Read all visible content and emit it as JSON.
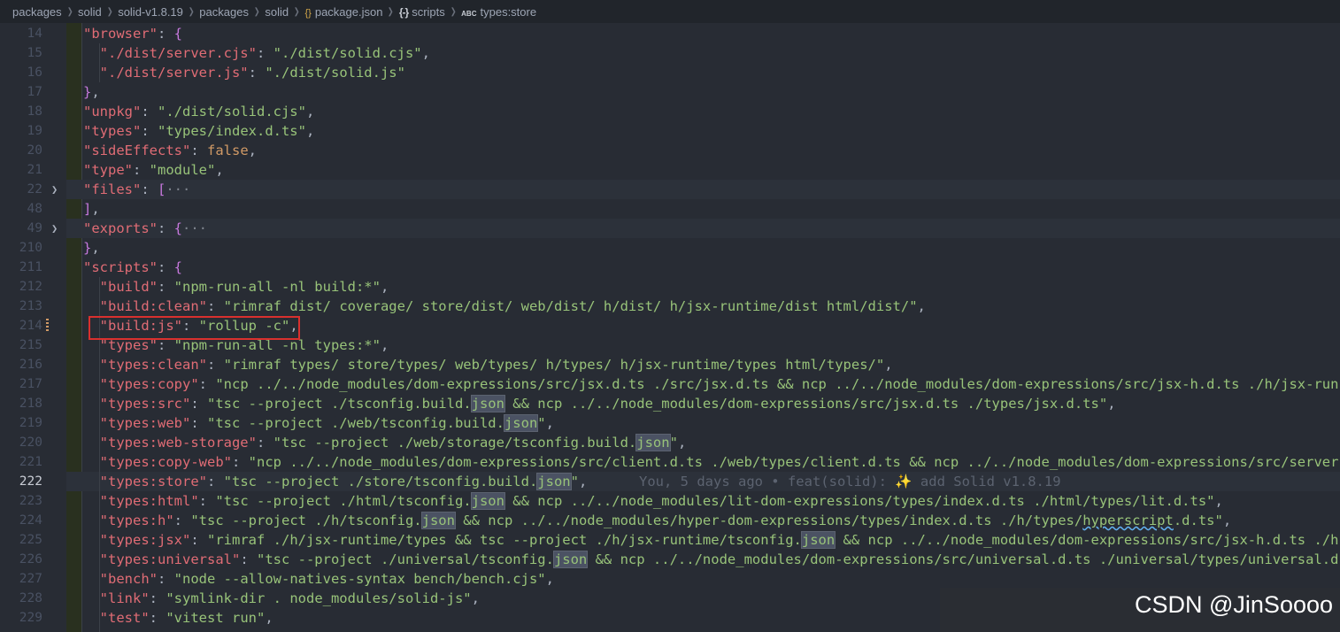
{
  "breadcrumb": [
    "packages",
    "solid",
    "solid-v1.8.19",
    "packages",
    "solid",
    "package.json",
    "scripts",
    "types:store"
  ],
  "icons": {
    "crumb_5": "json-file-icon",
    "crumb_6": "braces-object-icon",
    "crumb_7": "string-abc-icon",
    "fold": "chevron-right-icon"
  },
  "lines": [
    {
      "n": "14",
      "tokens": [
        [
          "k",
          "\"browser\""
        ],
        [
          "p",
          ": "
        ],
        [
          "b",
          "{"
        ]
      ]
    },
    {
      "n": "15",
      "tokens": [
        [
          "p",
          "  "
        ],
        [
          "k",
          "\"./dist/server.cjs\""
        ],
        [
          "p",
          ": "
        ],
        [
          "s",
          "\"./dist/solid.cjs\""
        ],
        [
          "p",
          ","
        ]
      ]
    },
    {
      "n": "16",
      "tokens": [
        [
          "p",
          "  "
        ],
        [
          "k",
          "\"./dist/server.js\""
        ],
        [
          "p",
          ": "
        ],
        [
          "s",
          "\"./dist/solid.js\""
        ]
      ]
    },
    {
      "n": "17",
      "tokens": [
        [
          "b",
          "}"
        ],
        [
          "p",
          ","
        ]
      ]
    },
    {
      "n": "18",
      "tokens": [
        [
          "k",
          "\"unpkg\""
        ],
        [
          "p",
          ": "
        ],
        [
          "s",
          "\"./dist/solid.cjs\""
        ],
        [
          "p",
          ","
        ]
      ]
    },
    {
      "n": "19",
      "tokens": [
        [
          "k",
          "\"types\""
        ],
        [
          "p",
          ": "
        ],
        [
          "s",
          "\"types/index.d.ts\""
        ],
        [
          "p",
          ","
        ]
      ]
    },
    {
      "n": "20",
      "tokens": [
        [
          "k",
          "\"sideEffects\""
        ],
        [
          "p",
          ": "
        ],
        [
          "bool",
          "false"
        ],
        [
          "p",
          ","
        ]
      ]
    },
    {
      "n": "21",
      "tokens": [
        [
          "k",
          "\"type\""
        ],
        [
          "p",
          ": "
        ],
        [
          "s",
          "\"module\""
        ],
        [
          "p",
          ","
        ]
      ]
    },
    {
      "n": "22",
      "fold": true,
      "hl": true,
      "tokens": [
        [
          "k",
          "\"files\""
        ],
        [
          "p",
          ": "
        ],
        [
          "b",
          "["
        ],
        [
          "ell",
          "···"
        ]
      ]
    },
    {
      "n": "48",
      "tokens": [
        [
          "b",
          "]"
        ],
        [
          "p",
          ","
        ]
      ]
    },
    {
      "n": "49",
      "fold": true,
      "hl": true,
      "tokens": [
        [
          "k",
          "\"exports\""
        ],
        [
          "p",
          ": "
        ],
        [
          "b",
          "{"
        ],
        [
          "ell",
          "···"
        ]
      ]
    },
    {
      "n": "210",
      "tokens": [
        [
          "b",
          "}"
        ],
        [
          "p",
          ","
        ]
      ]
    },
    {
      "n": "211",
      "tokens": [
        [
          "k",
          "\"scripts\""
        ],
        [
          "p",
          ": "
        ],
        [
          "b",
          "{"
        ]
      ]
    },
    {
      "n": "212",
      "tokens": [
        [
          "p",
          "  "
        ],
        [
          "k",
          "\"build\""
        ],
        [
          "p",
          ": "
        ],
        [
          "s",
          "\"npm-run-all -nl build:*\""
        ],
        [
          "p",
          ","
        ]
      ]
    },
    {
      "n": "213",
      "tokens": [
        [
          "p",
          "  "
        ],
        [
          "k",
          "\"build:clean\""
        ],
        [
          "p",
          ": "
        ],
        [
          "s",
          "\"rimraf dist/ coverage/ store/dist/ web/dist/ h/dist/ h/jsx-runtime/dist html/dist/\""
        ],
        [
          "p",
          ","
        ]
      ]
    },
    {
      "n": "214",
      "mod": true,
      "tokens": [
        [
          "p",
          "  "
        ],
        [
          "k",
          "\"build:js\""
        ],
        [
          "p",
          ": "
        ],
        [
          "s",
          "\"rollup -c\""
        ],
        [
          "p",
          ","
        ]
      ]
    },
    {
      "n": "215",
      "tokens": [
        [
          "p",
          "  "
        ],
        [
          "k",
          "\"types\""
        ],
        [
          "p",
          ": "
        ],
        [
          "s",
          "\"npm-run-all -nl types:*\""
        ],
        [
          "p",
          ","
        ]
      ]
    },
    {
      "n": "216",
      "tokens": [
        [
          "p",
          "  "
        ],
        [
          "k",
          "\"types:clean\""
        ],
        [
          "p",
          ": "
        ],
        [
          "s",
          "\"rimraf types/ store/types/ web/types/ h/types/ h/jsx-runtime/types html/types/\""
        ],
        [
          "p",
          ","
        ]
      ]
    },
    {
      "n": "217",
      "tokens": [
        [
          "p",
          "  "
        ],
        [
          "k",
          "\"types:copy\""
        ],
        [
          "p",
          ": "
        ],
        [
          "s",
          "\"ncp ../../node_modules/dom-expressions/src/jsx.d.ts ./src/jsx.d.ts && ncp ../../node_modules/dom-expressions/src/jsx-h.d.ts ./h/jsx-run"
        ]
      ]
    },
    {
      "n": "218",
      "tokens": [
        [
          "p",
          "  "
        ],
        [
          "k",
          "\"types:src\""
        ],
        [
          "p",
          ": "
        ],
        [
          "s",
          "\"tsc --project ./tsconfig.build."
        ],
        [
          "sm",
          "json"
        ],
        [
          "s",
          " && ncp ../../node_modules/dom-expressions/src/jsx.d.ts ./types/jsx.d.ts\""
        ],
        [
          "p",
          ","
        ]
      ]
    },
    {
      "n": "219",
      "tokens": [
        [
          "p",
          "  "
        ],
        [
          "k",
          "\"types:web\""
        ],
        [
          "p",
          ": "
        ],
        [
          "s",
          "\"tsc --project ./web/tsconfig.build."
        ],
        [
          "sm",
          "json"
        ],
        [
          "s",
          "\""
        ],
        [
          "p",
          ","
        ]
      ]
    },
    {
      "n": "220",
      "tokens": [
        [
          "p",
          "  "
        ],
        [
          "k",
          "\"types:web-storage\""
        ],
        [
          "p",
          ": "
        ],
        [
          "s",
          "\"tsc --project ./web/storage/tsconfig.build."
        ],
        [
          "sm",
          "json"
        ],
        [
          "s",
          "\""
        ],
        [
          "p",
          ","
        ]
      ]
    },
    {
      "n": "221",
      "tokens": [
        [
          "p",
          "  "
        ],
        [
          "k",
          "\"types:copy-web\""
        ],
        [
          "p",
          ": "
        ],
        [
          "s",
          "\"ncp ../../node_modules/dom-expressions/src/client.d.ts ./web/types/client.d.ts && ncp ../../node_modules/dom-expressions/src/server"
        ]
      ]
    },
    {
      "n": "222",
      "current": true,
      "hl": true,
      "tokens": [
        [
          "p",
          "  "
        ],
        [
          "k",
          "\"types:store\""
        ],
        [
          "p",
          ": "
        ],
        [
          "s",
          "\"tsc --project ./store/tsconfig.build."
        ],
        [
          "sm",
          "json"
        ],
        [
          "s",
          "\""
        ],
        [
          "p",
          ","
        ]
      ]
    },
    {
      "n": "223",
      "tokens": [
        [
          "p",
          "  "
        ],
        [
          "k",
          "\"types:html\""
        ],
        [
          "p",
          ": "
        ],
        [
          "s",
          "\"tsc --project ./html/tsconfig."
        ],
        [
          "sm",
          "json"
        ],
        [
          "s",
          " && ncp ../../node_modules/lit-dom-expressions/types/index.d.ts ./html/types/lit.d.ts\""
        ],
        [
          "p",
          ","
        ]
      ]
    },
    {
      "n": "224",
      "tokens": [
        [
          "p",
          "  "
        ],
        [
          "k",
          "\"types:h\""
        ],
        [
          "p",
          ": "
        ],
        [
          "s",
          "\"tsc --project ./h/tsconfig."
        ],
        [
          "sm",
          "json"
        ],
        [
          "s",
          " && ncp ../../node_modules/hyper-dom-expressions/types/index.d.ts ./h/types/"
        ],
        [
          "sw",
          "hyperscript"
        ],
        [
          "s",
          ".d.ts\""
        ],
        [
          "p",
          ","
        ]
      ]
    },
    {
      "n": "225",
      "tokens": [
        [
          "p",
          "  "
        ],
        [
          "k",
          "\"types:jsx\""
        ],
        [
          "p",
          ": "
        ],
        [
          "s",
          "\"rimraf ./h/jsx-runtime/types && tsc --project ./h/jsx-runtime/tsconfig."
        ],
        [
          "sm",
          "json"
        ],
        [
          "s",
          " && ncp ../../node_modules/dom-expressions/src/jsx-h.d.ts ./h"
        ]
      ]
    },
    {
      "n": "226",
      "tokens": [
        [
          "p",
          "  "
        ],
        [
          "k",
          "\"types:universal\""
        ],
        [
          "p",
          ": "
        ],
        [
          "s",
          "\"tsc --project ./universal/tsconfig."
        ],
        [
          "sm",
          "json"
        ],
        [
          "s",
          " && ncp ../../node_modules/dom-expressions/src/universal.d.ts ./universal/types/universal.d"
        ]
      ]
    },
    {
      "n": "227",
      "tokens": [
        [
          "p",
          "  "
        ],
        [
          "k",
          "\"bench\""
        ],
        [
          "p",
          ": "
        ],
        [
          "s",
          "\"node --allow-natives-syntax bench/bench.cjs\""
        ],
        [
          "p",
          ","
        ]
      ]
    },
    {
      "n": "228",
      "tokens": [
        [
          "p",
          "  "
        ],
        [
          "k",
          "\"link\""
        ],
        [
          "p",
          ": "
        ],
        [
          "s",
          "\"symlink-dir . node_modules/solid-js\""
        ],
        [
          "p",
          ","
        ]
      ]
    },
    {
      "n": "229",
      "tokens": [
        [
          "p",
          "  "
        ],
        [
          "k",
          "\"test\""
        ],
        [
          "p",
          ": "
        ],
        [
          "s",
          "\"vitest run\""
        ],
        [
          "p",
          ","
        ]
      ]
    }
  ],
  "blame": "You, 5 days ago • feat(solid): ✨ add Solid v1.8.19",
  "watermark": "CSDN @JinSoooo",
  "colors": {
    "key": "#e06c75",
    "string": "#98c379",
    "bracket": "#c678dd",
    "boolean": "#d19a66",
    "annotation_box": "#d9302e"
  }
}
